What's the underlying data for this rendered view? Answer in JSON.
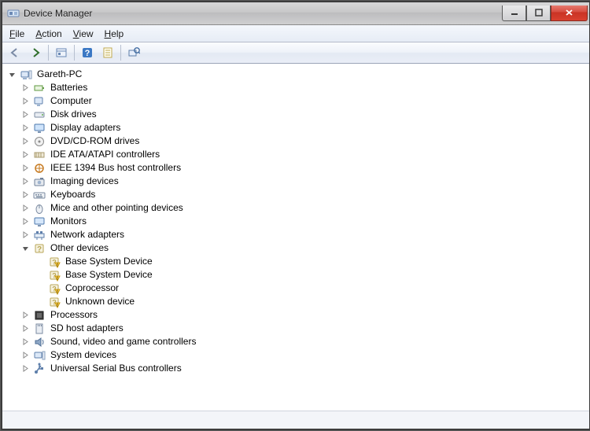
{
  "window": {
    "title": "Device Manager"
  },
  "menu": {
    "file": "File",
    "action": "Action",
    "view": "View",
    "help": "Help"
  },
  "toolbar": {
    "back": "Back",
    "forward": "Forward",
    "show_hidden": "Show hidden devices",
    "help": "Help",
    "properties": "Properties",
    "scan": "Scan for hardware changes"
  },
  "tree": {
    "root": "Gareth-PC",
    "categories": [
      {
        "label": "Batteries",
        "icon": "battery",
        "expanded": false
      },
      {
        "label": "Computer",
        "icon": "computer",
        "expanded": false
      },
      {
        "label": "Disk drives",
        "icon": "disk",
        "expanded": false
      },
      {
        "label": "Display adapters",
        "icon": "display",
        "expanded": false
      },
      {
        "label": "DVD/CD-ROM drives",
        "icon": "optical",
        "expanded": false
      },
      {
        "label": "IDE ATA/ATAPI controllers",
        "icon": "ide",
        "expanded": false
      },
      {
        "label": "IEEE 1394 Bus host controllers",
        "icon": "firewire",
        "expanded": false
      },
      {
        "label": "Imaging devices",
        "icon": "camera",
        "expanded": false
      },
      {
        "label": "Keyboards",
        "icon": "keyboard",
        "expanded": false
      },
      {
        "label": "Mice and other pointing devices",
        "icon": "mouse",
        "expanded": false
      },
      {
        "label": "Monitors",
        "icon": "monitor",
        "expanded": false
      },
      {
        "label": "Network adapters",
        "icon": "network",
        "expanded": false
      },
      {
        "label": "Other devices",
        "icon": "other",
        "expanded": true,
        "children": [
          {
            "label": "Base System Device",
            "icon": "warn"
          },
          {
            "label": "Base System Device",
            "icon": "warn"
          },
          {
            "label": "Coprocessor",
            "icon": "warn"
          },
          {
            "label": "Unknown device",
            "icon": "warn"
          }
        ]
      },
      {
        "label": "Processors",
        "icon": "cpu",
        "expanded": false
      },
      {
        "label": "SD host adapters",
        "icon": "sd",
        "expanded": false
      },
      {
        "label": "Sound, video and game controllers",
        "icon": "sound",
        "expanded": false
      },
      {
        "label": "System devices",
        "icon": "system",
        "expanded": false
      },
      {
        "label": "Universal Serial Bus controllers",
        "icon": "usb",
        "expanded": false
      }
    ]
  }
}
